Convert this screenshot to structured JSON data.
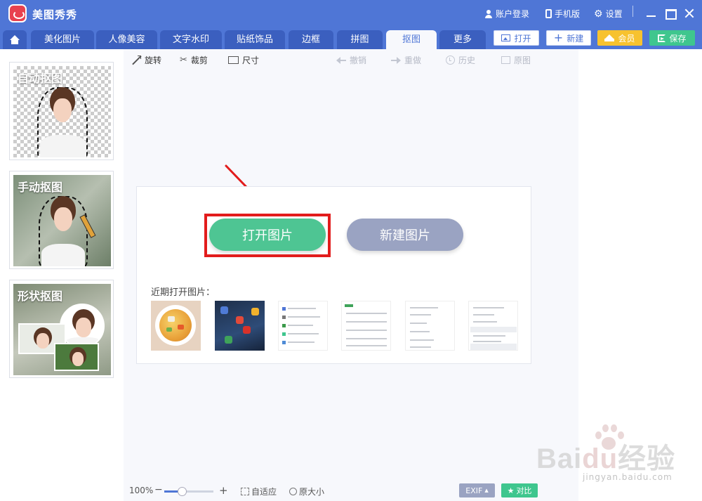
{
  "titlebar": {
    "app_name": "美图秀秀",
    "account_login": "账户登录",
    "mobile_version": "手机版",
    "settings": "设置"
  },
  "tabs": {
    "items": [
      "美化图片",
      "人像美容",
      "文字水印",
      "贴纸饰品",
      "边框",
      "拼图",
      "抠图",
      "更多"
    ],
    "active": "抠图"
  },
  "actions": {
    "open": "打开",
    "new": "新建",
    "vip": "会员",
    "save": "保存"
  },
  "toolbar": {
    "rotate": "旋转",
    "crop": "裁剪",
    "size": "尺寸",
    "undo": "撤销",
    "redo": "重做",
    "history": "历史",
    "original": "原图"
  },
  "sidebar": {
    "cards": [
      "自动抠图",
      "手动抠图",
      "形状抠图"
    ]
  },
  "dialog": {
    "open_image": "打开图片",
    "new_image": "新建图片",
    "recent_label": "近期打开图片："
  },
  "statusbar": {
    "zoom": "100%",
    "zoom_level": 0.35,
    "fit": "自适应",
    "actual_size": "原大小",
    "exif": "EXIF",
    "compare": "对比"
  },
  "watermark": {
    "brand_a": "Bai",
    "brand_b": "du",
    "brand_c": "经验",
    "url": "jingyan.baidu.com"
  },
  "colors": {
    "primary": "#4f76d6",
    "green": "#3fc68e",
    "gold": "#f7c22f",
    "highlight_red": "#e21c1c"
  }
}
